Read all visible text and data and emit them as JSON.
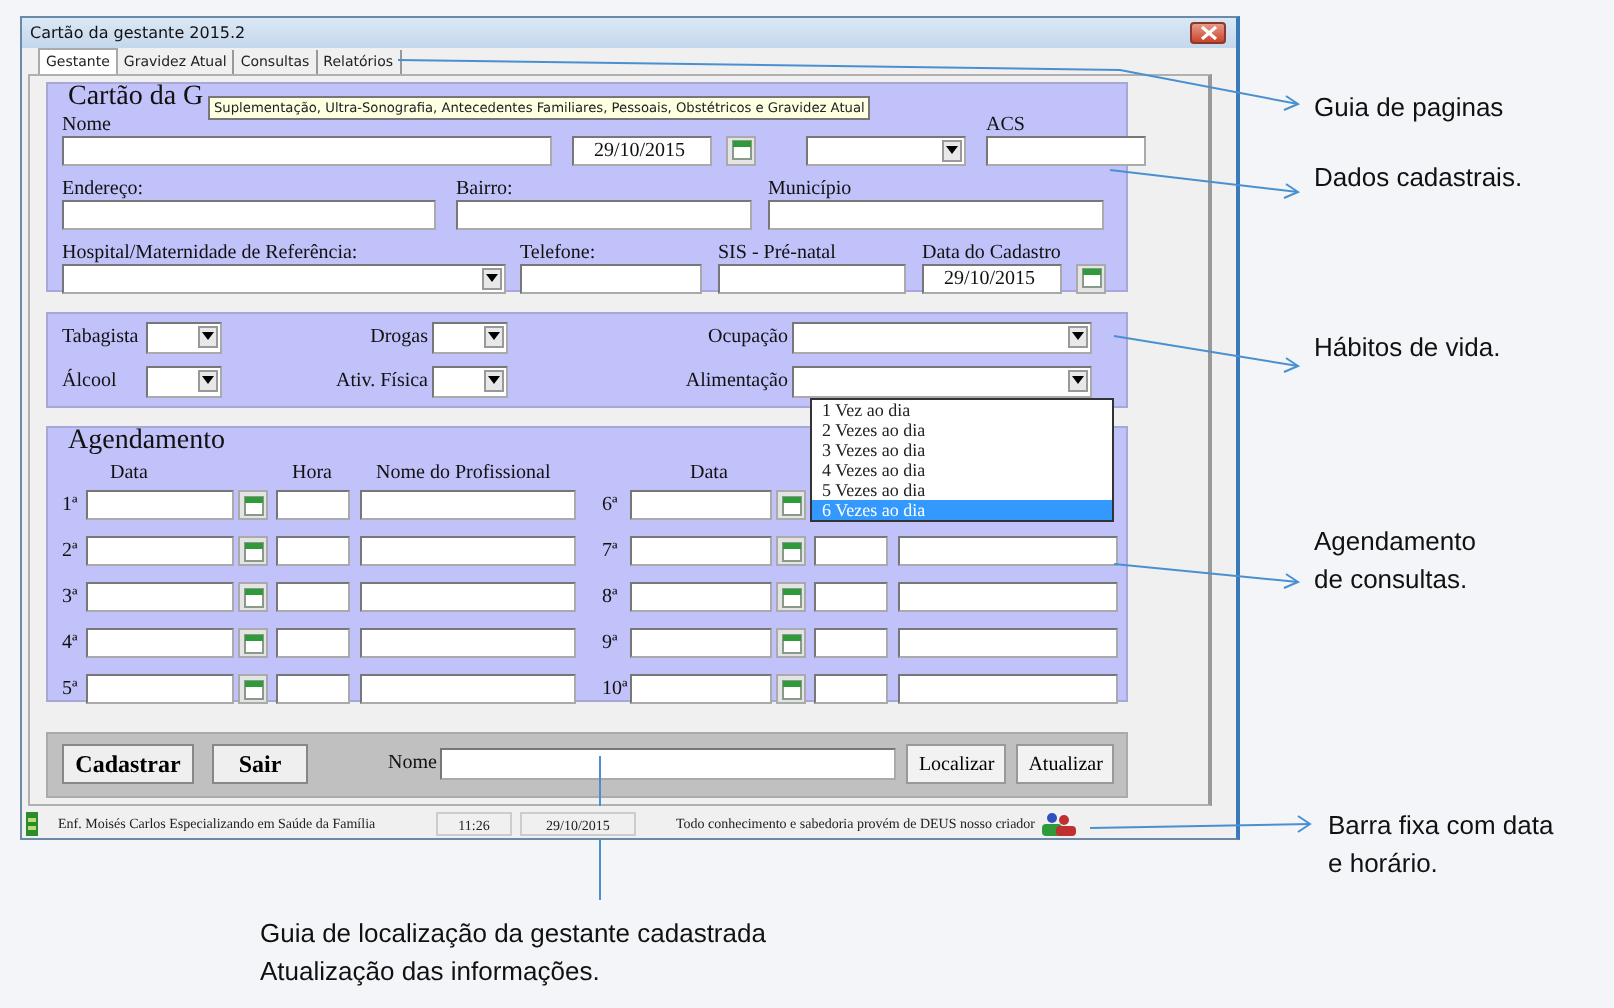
{
  "window": {
    "title": "Cartão da gestante 2015.2"
  },
  "tabs": [
    {
      "label": "Gestante",
      "selected": true
    },
    {
      "label": "Gravidez Atual",
      "selected": false
    },
    {
      "label": "Consultas",
      "selected": false
    },
    {
      "label": "Relatórios",
      "selected": false
    }
  ],
  "tooltip": "Suplementação, Ultra-Sonografia, Antecedentes Familiares, Pessoais, Obstétricos  e Gravidez Atual",
  "cartao": {
    "title": "Cartão da G",
    "rows": [
      [
        {
          "label": "Nome",
          "kind": "text"
        },
        {
          "kind": "date",
          "value": "29/10/2015"
        },
        {
          "kind": "select"
        },
        {
          "label": "ACS",
          "kind": "text"
        }
      ],
      [
        {
          "label": "Endereço:",
          "kind": "text"
        },
        {
          "label": "Bairro:",
          "kind": "text"
        },
        {
          "label": "Município",
          "kind": "text"
        }
      ],
      [
        {
          "label": "Hospital/Maternidade de Referência:",
          "kind": "select"
        },
        {
          "label": "Telefone:",
          "kind": "text"
        },
        {
          "label": "SIS - Pré-natal",
          "kind": "text"
        },
        {
          "label": "Data do Cadastro",
          "kind": "date",
          "value": "29/10/2015"
        }
      ]
    ]
  },
  "habitos": [
    {
      "label": "Tabagista"
    },
    {
      "label": "Drogas"
    },
    {
      "label": "Ocupação"
    },
    {
      "label": "Álcool"
    },
    {
      "label": "Ativ. Física"
    },
    {
      "label": "Alimentação"
    }
  ],
  "alimentacao_list": [
    {
      "label": "1 Vez ao dia",
      "selected": false
    },
    {
      "label": "2 Vezes ao dia",
      "selected": false
    },
    {
      "label": "3 Vezes ao dia",
      "selected": false
    },
    {
      "label": "4 Vezes ao dia",
      "selected": false
    },
    {
      "label": "5 Vezes ao dia",
      "selected": false
    },
    {
      "label": "6 Vezes ao dia",
      "selected": true
    }
  ],
  "agendamento": {
    "title": "Agendamento",
    "headers_left": [
      "Data",
      "Hora",
      "Nome do Profissional"
    ],
    "header_right": "Data",
    "rows_left": [
      "1ª",
      "2ª",
      "3ª",
      "4ª",
      "5ª"
    ],
    "rows_right": [
      {
        "label": "6ª",
        "kind": "date_only"
      },
      {
        "label": "7ª",
        "kind": "full"
      },
      {
        "label": "8ª",
        "kind": "full"
      },
      {
        "label": "9ª",
        "kind": "full"
      },
      {
        "label": "10ª",
        "kind": "full"
      }
    ]
  },
  "bottom_bar": {
    "buttons_left": [
      "Cadastrar",
      "Sair"
    ],
    "search_label": "Nome",
    "buttons_right": [
      "Localizar",
      "Atualizar"
    ]
  },
  "status_bar": {
    "author": "Enf. Moisés Carlos Especializando em Saúde da Família",
    "time": "11:26",
    "date": "29/10/2015",
    "motto": "Todo conhecimento e sabedoria provém de DEUS nosso criador"
  },
  "annotations": [
    {
      "lines": [
        "Guia de paginas"
      ]
    },
    {
      "lines": [
        "Dados cadastrais."
      ]
    },
    {
      "lines": [
        "Hábitos de vida."
      ]
    },
    {
      "lines": [
        "Agendamento",
        "de consultas."
      ]
    },
    {
      "lines": [
        "Barra fixa com data",
        "e horário."
      ]
    },
    {
      "lines": [
        "Guia de localização da gestante cadastrada",
        "Atualização das informações."
      ]
    }
  ]
}
